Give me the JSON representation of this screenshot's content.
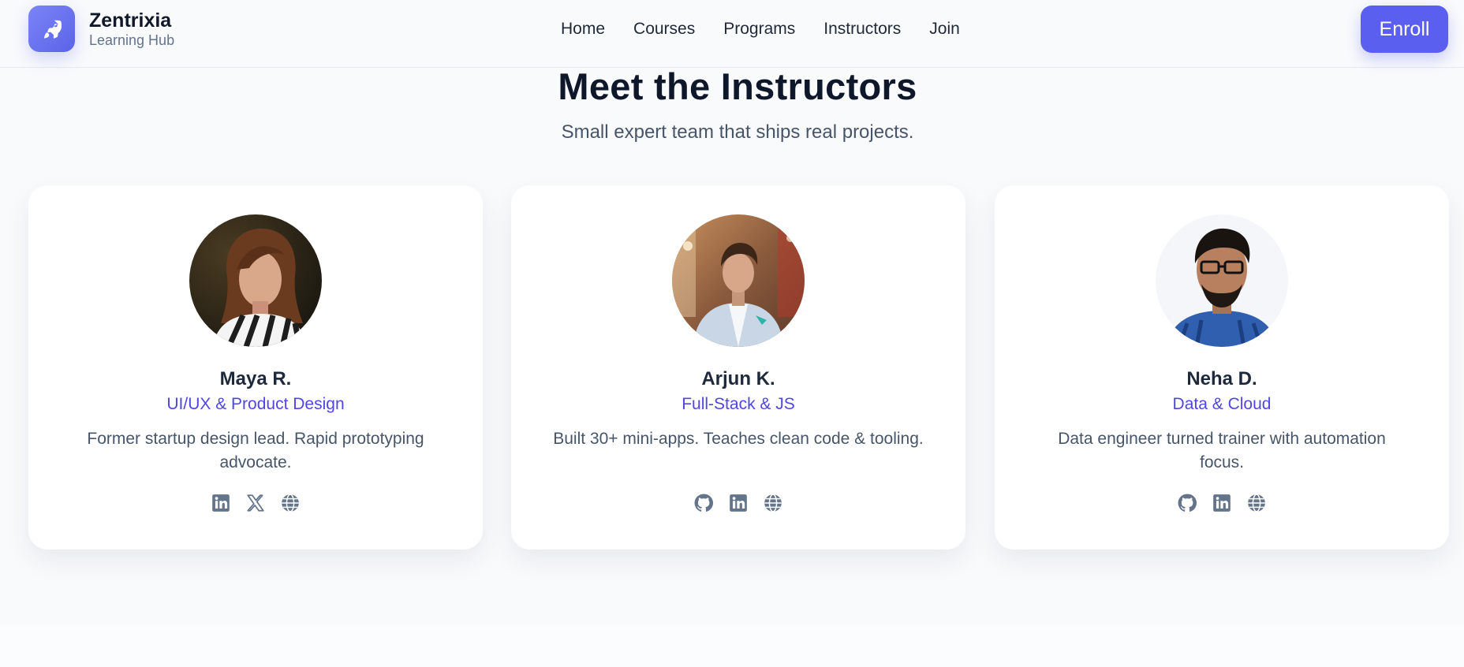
{
  "brand": {
    "name": "Zentrixia",
    "subtitle": "Learning Hub",
    "icon": "rocket-icon",
    "accent": "#5b63e8"
  },
  "nav": {
    "items": [
      "Home",
      "Courses",
      "Programs",
      "Instructors",
      "Join"
    ]
  },
  "header": {
    "cta_label": "Enroll",
    "cta_color": "#5b5ff0"
  },
  "section": {
    "title": "Meet the Instructors",
    "subtitle": "Small expert team that ships real projects."
  },
  "instructors": [
    {
      "name": "Maya R.",
      "role": "UI/UX & Product Design",
      "bio": "Former startup design lead. Rapid prototyping advocate.",
      "socials": [
        "linkedin-icon",
        "x-icon",
        "globe-icon"
      ]
    },
    {
      "name": "Arjun K.",
      "role": "Full-Stack & JS",
      "bio": "Built 30+ mini-apps. Teaches clean code & tooling.",
      "socials": [
        "github-icon",
        "linkedin-icon",
        "globe-icon"
      ]
    },
    {
      "name": "Neha D.",
      "role": "Data & Cloud",
      "bio": "Data engineer turned trainer with automation focus.",
      "socials": [
        "github-icon",
        "linkedin-icon",
        "globe-icon"
      ]
    }
  ],
  "colors": {
    "role_text": "#4f46e5",
    "icon": "#64748b"
  }
}
